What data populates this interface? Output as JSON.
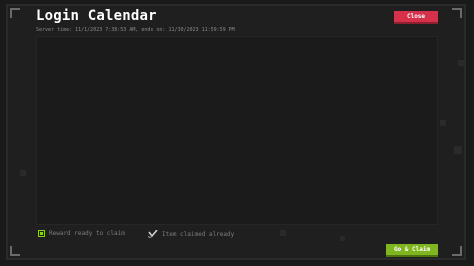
{
  "header": {
    "title": "Login Calendar",
    "server_time": "Server time: 11/1/2023 7:38:53 AM, ends on: 11/30/2023 11:59:59 PM",
    "close_label": "Close"
  },
  "legend": {
    "ready_label": "Reward ready to claim",
    "claimed_label": "Item claimed already"
  },
  "footer": {
    "go_claim_label": "Go & Claim"
  },
  "colors": {
    "close_button": "#d5314a",
    "go_button": "#7fb51f",
    "ready_indicator": "#8fcc2a"
  }
}
